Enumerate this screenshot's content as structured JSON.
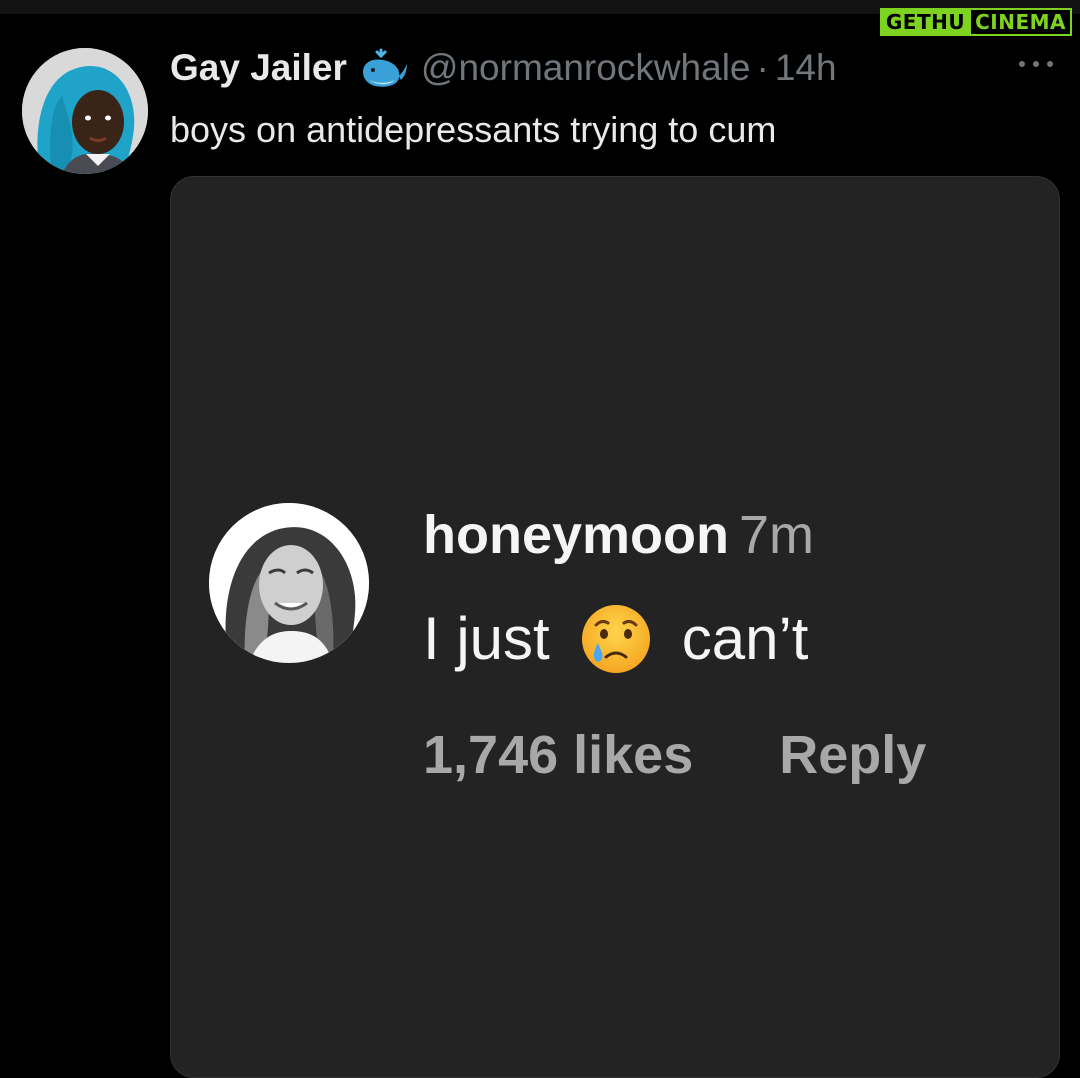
{
  "watermark": {
    "part_a": "GETHU",
    "part_b": "CINEMA",
    "color": "#7ed321"
  },
  "tweet": {
    "display_name": "Gay Jailer",
    "badge_icon": "whale-emoji-icon",
    "handle": "@normanrockwhale",
    "separator": "·",
    "time": "14h",
    "more_icon": "more-horizontal-icon",
    "text": "boys on antidepressants trying to cum"
  },
  "embedded_comment": {
    "username": "honeymoon",
    "time": "7m",
    "text_before": "I just",
    "emoji": "crying-face-emoji-icon",
    "text_after": "can’t",
    "likes": "1,746 likes",
    "reply": "Reply"
  },
  "colors": {
    "background": "#000000",
    "card": "#232323",
    "secondary_text": "#71767b",
    "primary_text": "#e7e9ea"
  }
}
